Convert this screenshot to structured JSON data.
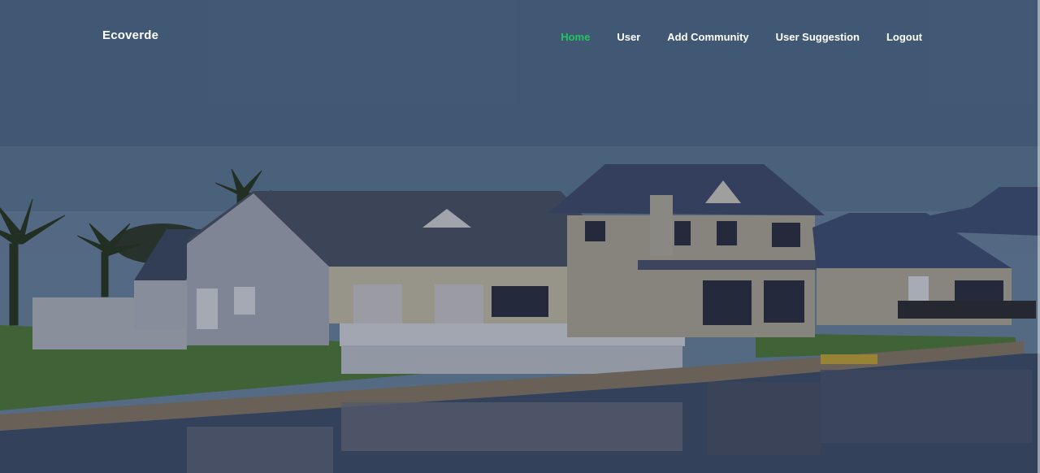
{
  "brand": {
    "name": "Ecoverde"
  },
  "nav": {
    "items": [
      {
        "label": "Home",
        "active": true
      },
      {
        "label": "User",
        "active": false
      },
      {
        "label": "Add Community",
        "active": false
      },
      {
        "label": "User Suggestion",
        "active": false
      },
      {
        "label": "Logout",
        "active": false
      }
    ]
  },
  "colors": {
    "active_link": "#22c55e",
    "link": "#ffffff",
    "overlay": "rgba(20,28,45,0.28)"
  },
  "hero": {
    "image": "lakeside-houses-photo"
  }
}
